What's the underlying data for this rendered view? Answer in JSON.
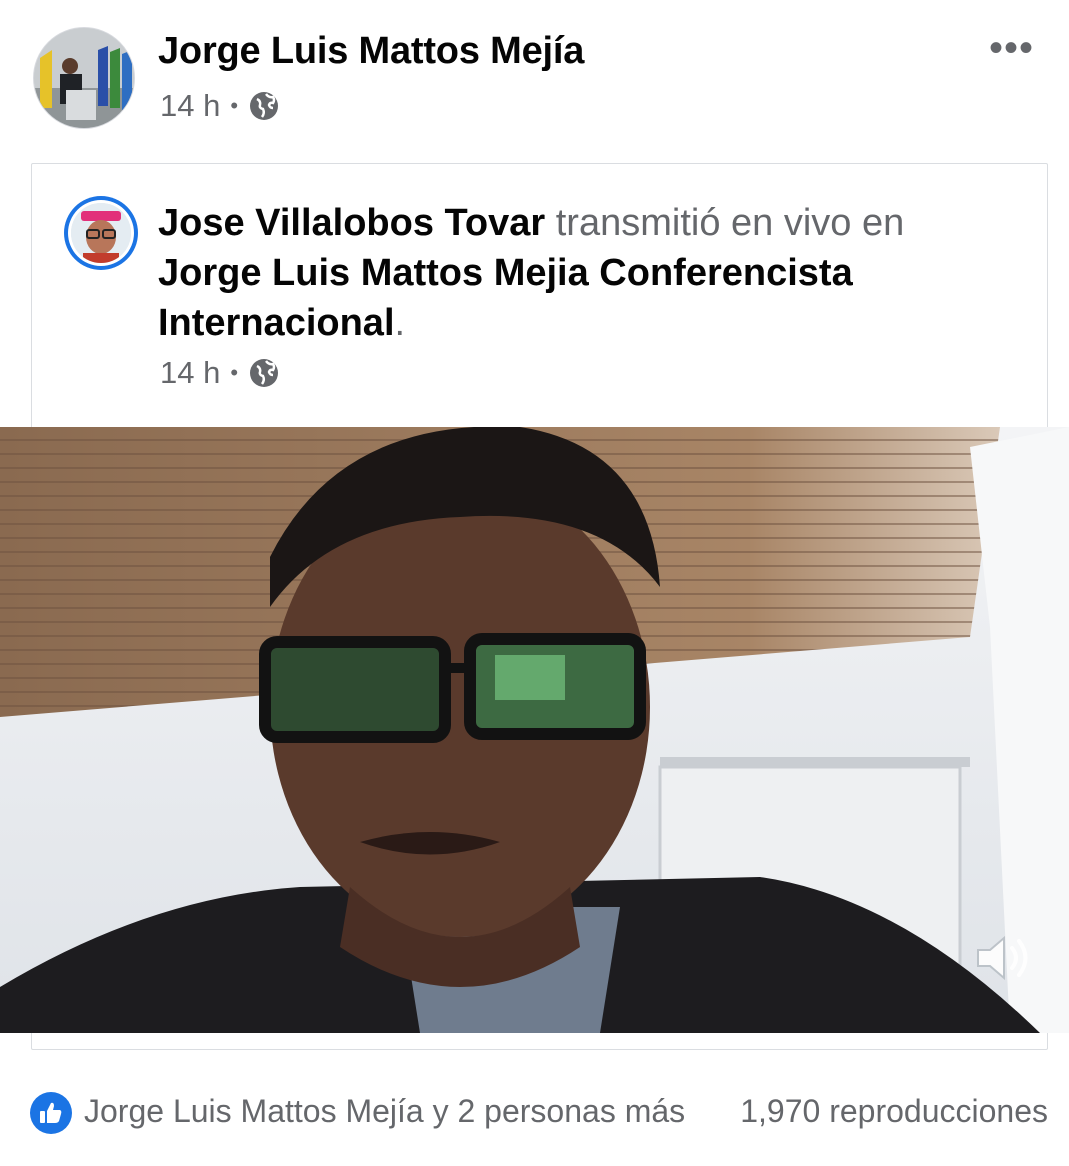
{
  "post": {
    "author": "Jorge Luis Mattos Mejía",
    "time": "14 h",
    "separator": "•",
    "privacy_icon": "globe-icon",
    "more_icon": "•••"
  },
  "shared": {
    "author": "Jose Villalobos Tovar",
    "verb": "transmitió en vivo en",
    "target": "Jorge Luis Mattos Mejia Conferencista Internacional",
    "period": ".",
    "time": "14 h",
    "separator": "•",
    "privacy_icon": "globe-icon"
  },
  "video": {
    "sound_icon": "speaker-icon"
  },
  "footer": {
    "reaction_icon": "like-icon",
    "reactors": "Jorge Luis Mattos Mejía y 2 personas más",
    "views": "1,970 reproducciones"
  },
  "colors": {
    "text_primary": "#050505",
    "text_secondary": "#65676b",
    "accent": "#1b74e4"
  }
}
